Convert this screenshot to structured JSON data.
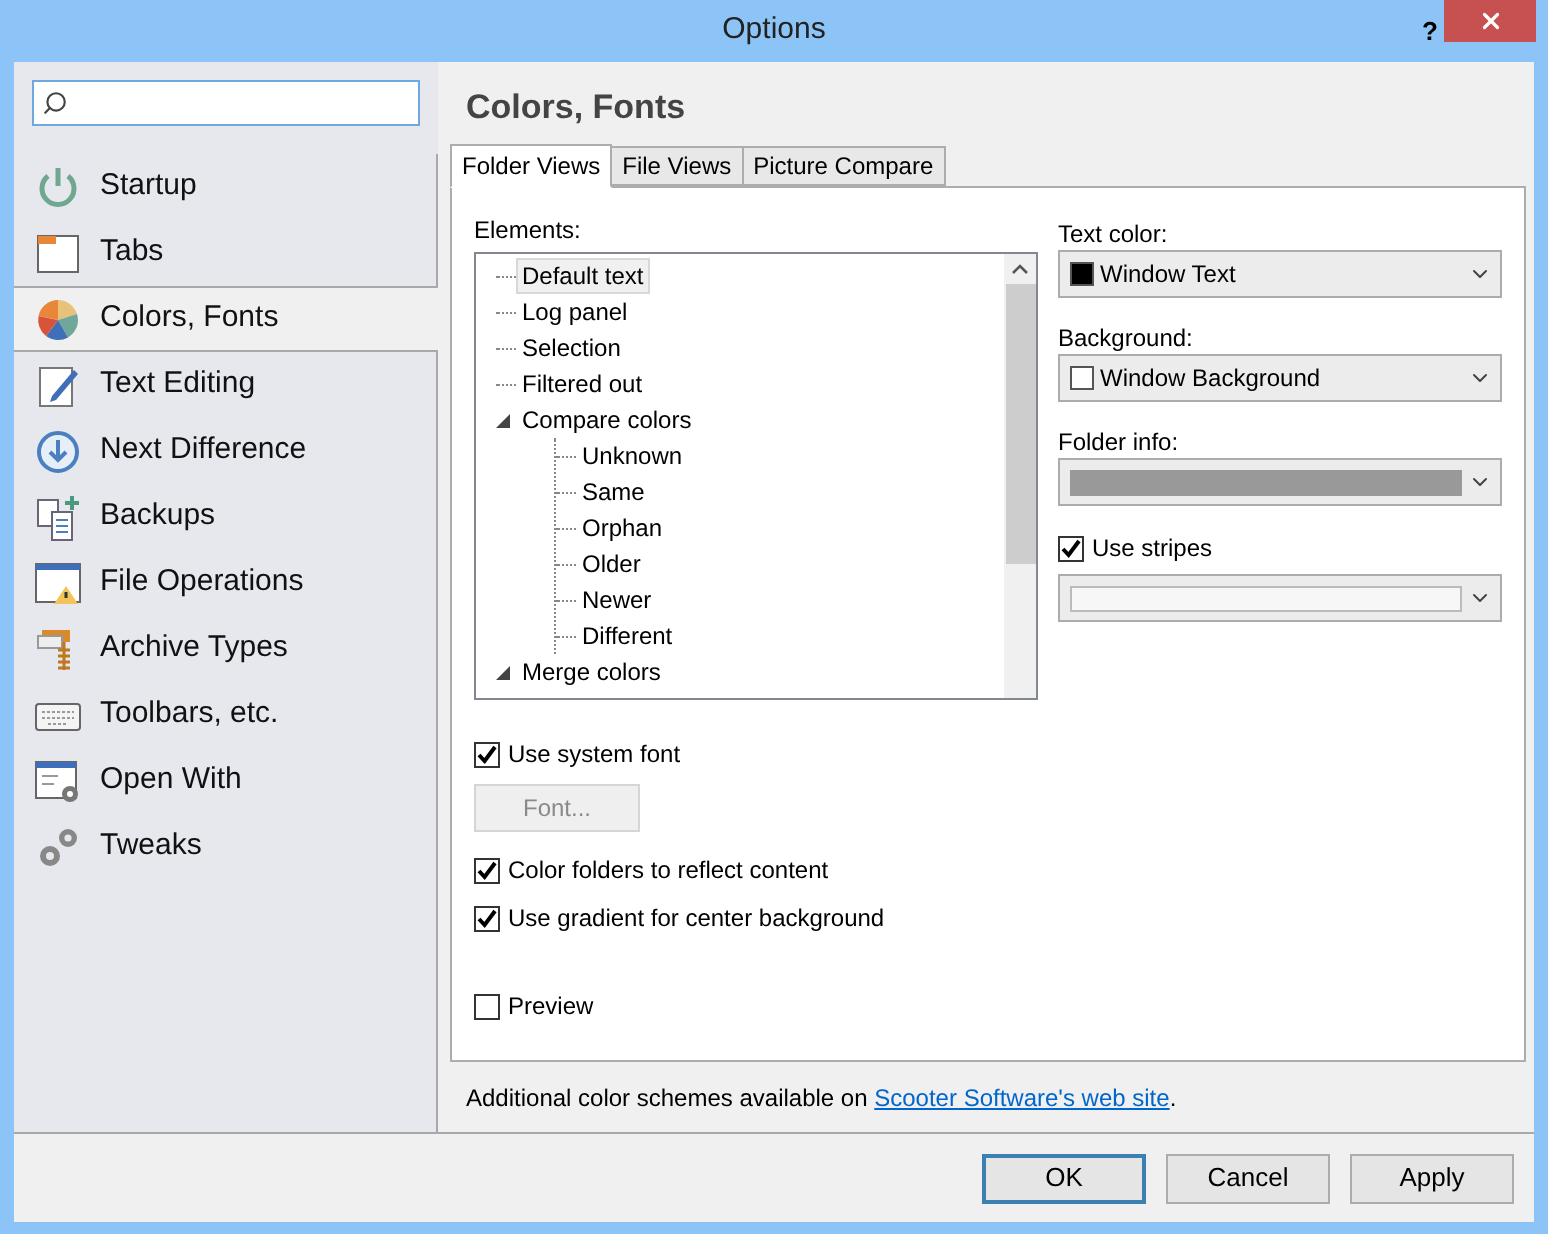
{
  "window": {
    "title": "Options",
    "help": "?"
  },
  "sidebar": {
    "items": [
      {
        "label": "Startup",
        "selected": false
      },
      {
        "label": "Tabs",
        "selected": false
      },
      {
        "label": "Colors, Fonts",
        "selected": true
      },
      {
        "label": "Text Editing",
        "selected": false
      },
      {
        "label": "Next Difference",
        "selected": false
      },
      {
        "label": "Backups",
        "selected": false
      },
      {
        "label": "File Operations",
        "selected": false
      },
      {
        "label": "Archive Types",
        "selected": false
      },
      {
        "label": "Toolbars, etc.",
        "selected": false
      },
      {
        "label": "Open With",
        "selected": false
      },
      {
        "label": "Tweaks",
        "selected": false
      }
    ]
  },
  "heading": "Colors, Fonts",
  "tabs": [
    {
      "label": "Folder Views",
      "selected": true
    },
    {
      "label": "File Views",
      "selected": false
    },
    {
      "label": "Picture Compare",
      "selected": false
    }
  ],
  "elements": {
    "label": "Elements:",
    "items": [
      {
        "label": "Default text",
        "selected": true
      },
      {
        "label": "Log panel",
        "selected": false
      },
      {
        "label": "Selection",
        "selected": false
      },
      {
        "label": "Filtered out",
        "selected": false
      },
      {
        "label": "Compare colors",
        "selected": false,
        "expanded": true,
        "children": [
          {
            "label": "Unknown",
            "selected": false
          },
          {
            "label": "Same",
            "selected": false
          },
          {
            "label": "Orphan",
            "selected": false
          },
          {
            "label": "Older",
            "selected": false
          },
          {
            "label": "Newer",
            "selected": false
          },
          {
            "label": "Different",
            "selected": false
          }
        ]
      },
      {
        "label": "Merge colors",
        "selected": false,
        "expanded": true
      }
    ]
  },
  "text_color": {
    "label": "Text color:",
    "value": "Window Text",
    "color": "#000000"
  },
  "background": {
    "label": "Background:",
    "value": "Window Background",
    "color": "#ffffff"
  },
  "folder_info": {
    "label": "Folder info:",
    "color": "#999999"
  },
  "use_stripes": {
    "label": "Use stripes",
    "checked": true
  },
  "stripes_color": {
    "color": "#f7f7f7"
  },
  "use_system_font": {
    "label": "Use system font",
    "checked": true
  },
  "font_button": {
    "label": "Font...",
    "disabled": true
  },
  "options": [
    {
      "label": "Color folders to reflect content",
      "checked": true
    },
    {
      "label": "Use gradient for center background",
      "checked": true
    }
  ],
  "preview": {
    "label": "Preview",
    "checked": false
  },
  "footer_note": {
    "text": "Additional color schemes available on ",
    "link": "Scooter Software's web site",
    "after": "."
  },
  "buttons": [
    {
      "label": "OK",
      "default": true
    },
    {
      "label": "Cancel",
      "default": false
    },
    {
      "label": "Apply",
      "default": false
    }
  ]
}
